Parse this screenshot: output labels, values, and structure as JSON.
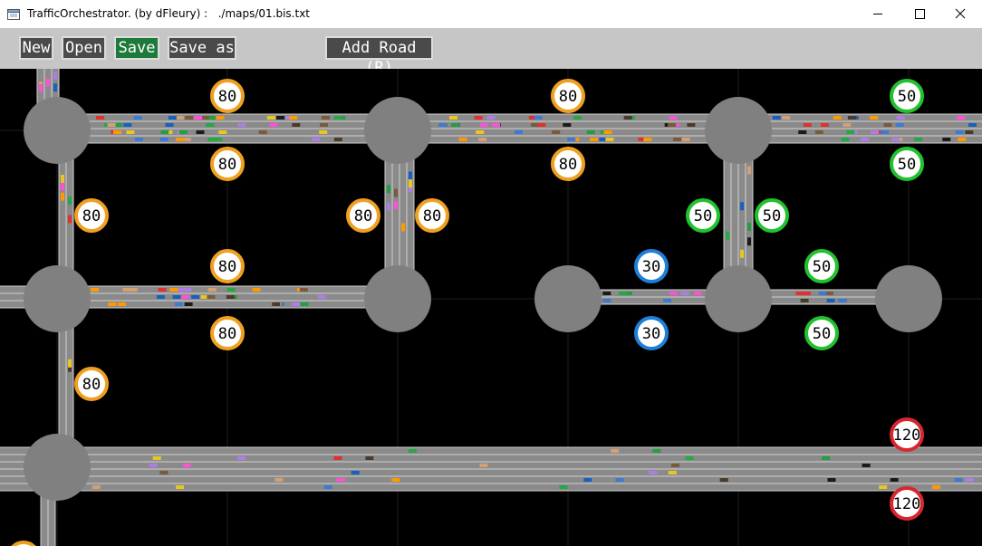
{
  "window": {
    "title": "TrafficOrchestrator. (by dFleury) :   ./maps/01.bis.txt",
    "icon": "app-window-icon",
    "controls": [
      "minimize-icon",
      "maximize-icon",
      "close-icon"
    ]
  },
  "toolbar": {
    "new_label": "New",
    "open_label": "Open",
    "save_label": "Save",
    "save_as_label": "Save as",
    "add_road_label": "Add Road (R)",
    "save_active_color": "#1e7a3a",
    "button_color": "#4a4a4a"
  },
  "map": {
    "background": "#000000",
    "road_color": "#8a8a8a",
    "lane_line_color": "#d0d0d0",
    "intersection_color": "#808080",
    "sign_colors": {
      "30": "#1e7fd8",
      "50": "#22c22e",
      "80": "#f0a020",
      "120": "#d8262e"
    },
    "speed_signs": [
      "80",
      "80",
      "80",
      "80",
      "50",
      "50",
      "80",
      "80",
      "80",
      "50",
      "50",
      "80",
      "30",
      "50",
      "80",
      "30",
      "50",
      "80",
      "120",
      "120"
    ]
  }
}
